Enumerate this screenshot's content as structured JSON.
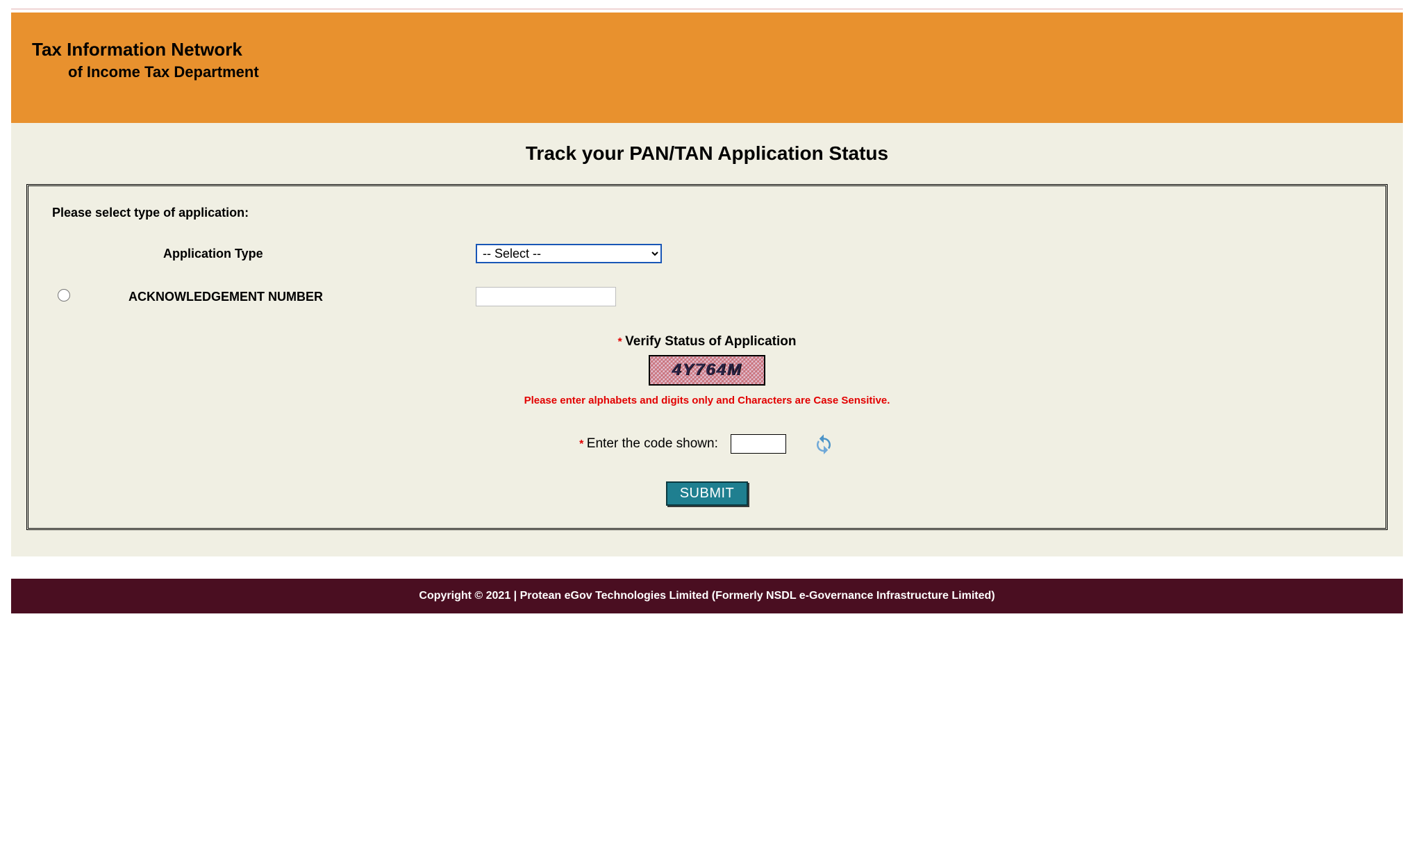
{
  "header": {
    "title": "Tax Information Network",
    "subtitle": "of Income Tax Department"
  },
  "page_title": "Track your PAN/TAN Application Status",
  "form": {
    "intro": "Please select type of application:",
    "rows": {
      "app_type_label": "Application Type",
      "app_type_selected": "-- Select --",
      "ack_label": "ACKNOWLEDGEMENT NUMBER",
      "ack_value": ""
    },
    "verify": {
      "title": "Verify Status of Application",
      "captcha_text": "4Y764M",
      "note": "Please enter alphabets and digits only and Characters are Case Sensitive.",
      "enter_code_label": "Enter the code shown:",
      "code_value": ""
    },
    "submit_label": "SUBMIT"
  },
  "footer": "Copyright © 2021 | Protean eGov Technologies Limited (Formerly NSDL e-Governance Infrastructure Limited)",
  "icons": {
    "refresh": "refresh-icon"
  }
}
